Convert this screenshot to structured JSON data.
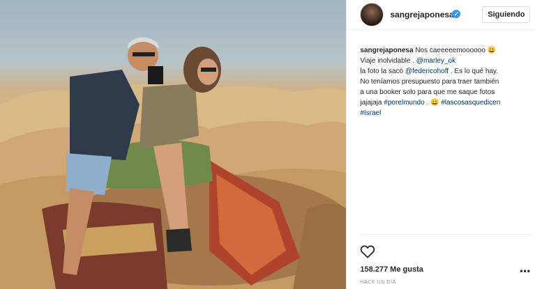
{
  "post": {
    "username": "sangrejaponesa",
    "follow_button": "Siguiendo",
    "caption": {
      "username": "sangrejaponesa",
      "line1": "Nos caeeeeemoooooo",
      "line1_emoji": "😀",
      "line2_text": "Viaje inolvidable . ",
      "line2_mention": "@marley_ok",
      "line3_text": "la foto la sacó ",
      "line3_mention": "@federicohoff",
      "line3_rest": " . Es lo qué hay.",
      "line4": "No teníamos presupuesto para traer también",
      "line5": "a una booker solo para que me saque fotos",
      "line6_text": "jajajaja ",
      "line6_tag1": "#porelmundo",
      "line6_mid": " . 😀 ",
      "line6_tag2": "#lascosasquedicen",
      "line7_tag": "#Israel"
    },
    "likes": "158.277 Me gusta",
    "timestamp": "HACE UN DÍA",
    "more_options": "•••"
  },
  "icons": {
    "avatar": "profile-avatar",
    "verified": "verified-badge-icon",
    "like": "heart-icon",
    "more": "ellipsis-icon"
  },
  "colors": {
    "link": "#003569",
    "verified": "#3897f0",
    "text": "#262626",
    "muted": "#999999"
  }
}
